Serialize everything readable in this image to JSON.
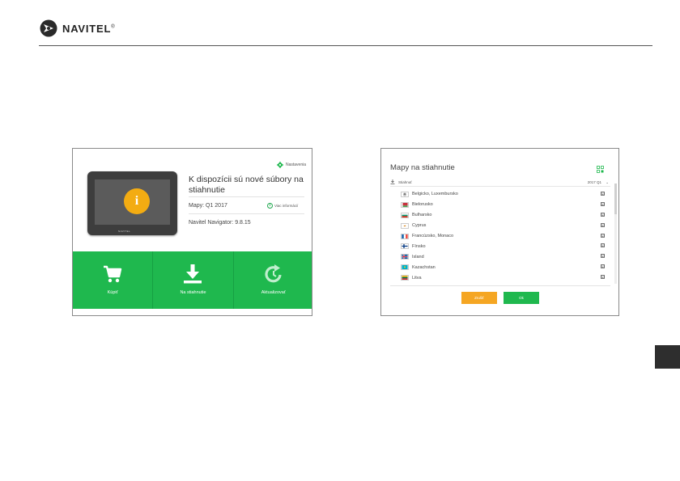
{
  "brand": {
    "name": "NAVITEL",
    "mark": "®"
  },
  "colors": {
    "green": "#1fb84e",
    "orange": "#f5a623",
    "info_yellow": "#f3ac12",
    "dark_tab": "#2e2e2e"
  },
  "update_screen": {
    "settings_label": "Nastavenia",
    "device_brand": "NAVITEL",
    "info_icon_glyph": "i",
    "title": "K dispozícii sú nové súbory na stiahnutie",
    "maps_version": "Mapy: Q1 2017",
    "more_info_label": "Viac informácií",
    "navigator_version": "Navitel Navigator: 9.8.15",
    "buttons": [
      {
        "label": "Kúpiť",
        "icon": "cart-icon"
      },
      {
        "label": "Na stiahnutie",
        "icon": "download-icon"
      },
      {
        "label": "Aktualizovať",
        "icon": "refresh-icon"
      }
    ]
  },
  "download_screen": {
    "title": "Mapy na stiahnutie",
    "header_label": "Stiahnuť",
    "header_version": "2017 Q1",
    "header_chevron": "⌄",
    "countries": [
      {
        "name": "Belgicko, Luxembursko",
        "checked": "☑"
      },
      {
        "name": "Bielorusko",
        "checked": "☑"
      },
      {
        "name": "Bulharsko",
        "checked": "☑"
      },
      {
        "name": "Cyprus",
        "checked": "☑"
      },
      {
        "name": "Francúzsko, Monaco",
        "checked": "☑"
      },
      {
        "name": "Fínsko",
        "checked": "☑"
      },
      {
        "name": "Island",
        "checked": "☑"
      },
      {
        "name": "Kazachstan",
        "checked": "☑"
      },
      {
        "name": "Litva",
        "checked": "☑"
      }
    ],
    "cancel_label": "Zrušiť",
    "ok_label": "Ok"
  }
}
